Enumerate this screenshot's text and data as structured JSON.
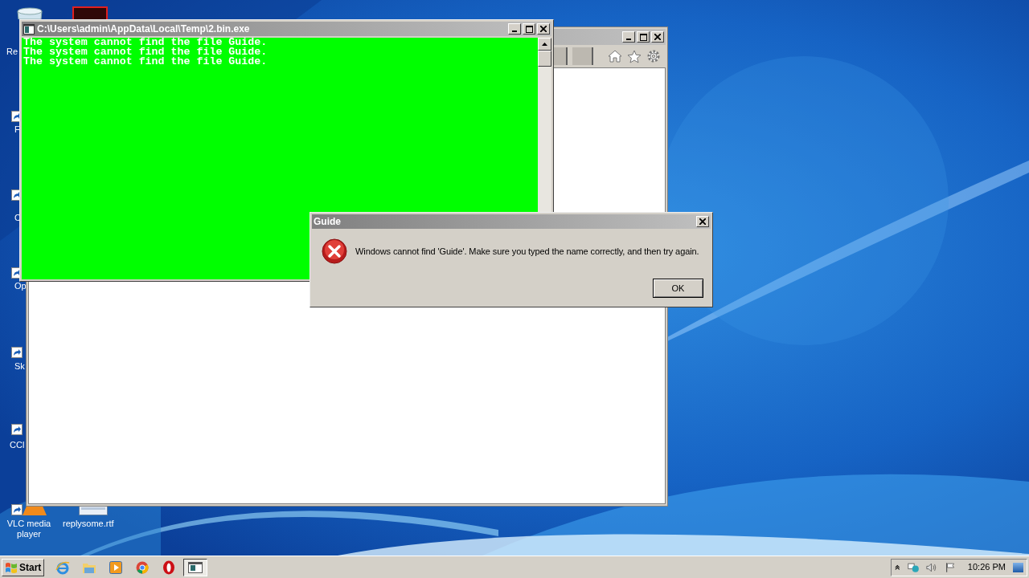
{
  "desktop_icons": [
    {
      "label": "Re"
    },
    {
      "label": "F"
    },
    {
      "label": "C"
    },
    {
      "label": "Op"
    },
    {
      "label": "Sk"
    },
    {
      "label": "CCl"
    },
    {
      "label": "VLC media player"
    },
    {
      "label": "replysome.rtf"
    }
  ],
  "browser_window": {
    "kind": "browser"
  },
  "console_window": {
    "title": "C:\\Users\\admin\\AppData\\Local\\Temp\\2.bin.exe",
    "lines": [
      "The system cannot find the file Guide.",
      "The system cannot find the file Guide.",
      "The system cannot find the file Guide."
    ]
  },
  "dialog": {
    "title": "Guide",
    "message": "Windows cannot find 'Guide'. Make sure you typed the name correctly, and then try again.",
    "buttons": [
      "OK"
    ]
  },
  "taskbar": {
    "start": "Start",
    "apps": [
      {
        "kind": "ie",
        "selected": false
      },
      {
        "kind": "folder",
        "selected": false
      },
      {
        "kind": "media",
        "selected": false
      },
      {
        "kind": "chrome",
        "selected": false
      },
      {
        "kind": "opera",
        "selected": false
      },
      {
        "kind": "console",
        "selected": true
      }
    ],
    "clock": "10:26 PM"
  }
}
